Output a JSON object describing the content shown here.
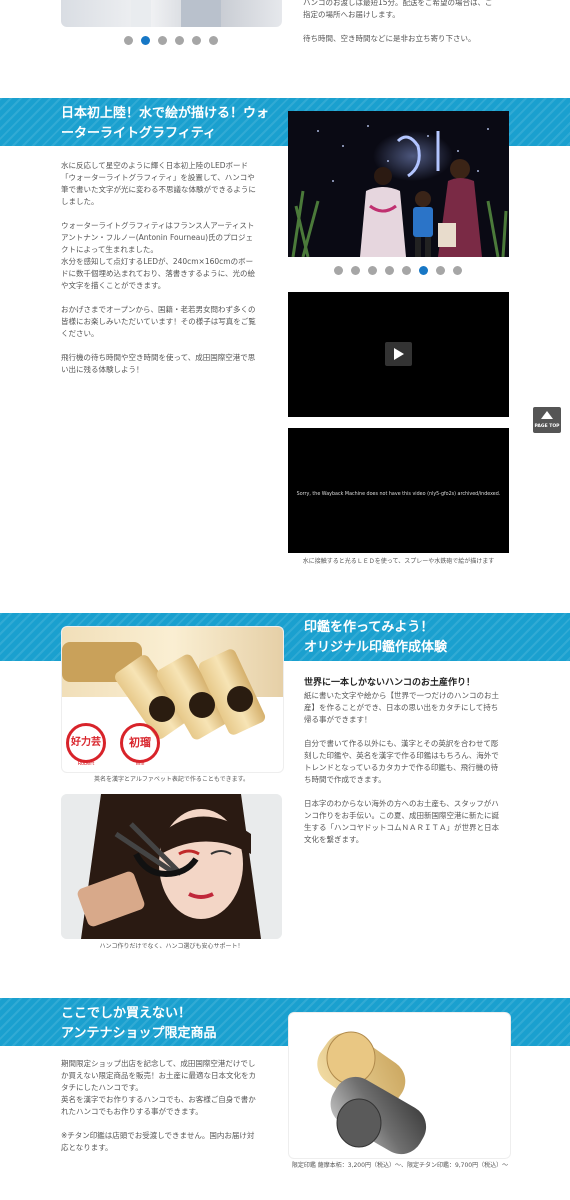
{
  "top": {
    "text_line1": "ハンコのお渡しは最短15分。配送をご希望の場合は、ご",
    "text_line2": "指定の場所へお届けします。",
    "text_line3": "待ち時間、空き時間などに是非お立ち寄り下さい。",
    "carousel_dots": 6,
    "carousel_active": 1
  },
  "section1": {
    "title": "日本初上陸！水で絵が描ける！ウォーターライトグラフィティ",
    "paragraphs": [
      "水に反応して星空のように輝く日本初上陸のLEDボード\n「ウォーターライトグラフィティ」を設置して、ハンコや\n筆で書いた文字が光に変わる不思議な体験ができるように\nしました。",
      "ウォーターライトグラフィティはフランス人アーティスト\nアントナン・フルノー(Antonin Fourneau)氏のプロジェ\nクトによって生まれました。\n水分を感知して点灯するLEDが、240cm×160cmのボー\nドに数千個埋め込まれており、落書きするように、光の絵\nや文字を描くことができます。",
      "おかげさまでオープンから、国籍・老若男女問わず多くの\n皆様にお楽しみいただいています！その様子は写真をご覧\nください。",
      "飛行機の待ち時間や空き時間を使って、成田国際空港で思\nい出に残る体験しよう！"
    ],
    "carousel_dots": 8,
    "carousel_active": 5,
    "video2_message": "Sorry, the Wayback Machine does not have this video (nly5-gfo2s) archived/indexed.",
    "video_caption": "水に接触すると光るＬＥＤを使って、スプレーや水鉄砲で絵が描けます"
  },
  "section2": {
    "title_line1": "印鑑を作ってみよう！",
    "title_line2": "オリジナル印鑑作成体験",
    "subheading": "世界に一本しかないハンコのお土産作り！",
    "paragraphs": [
      "紙に書いた文字や絵から【世界で一つだけのハンコのお土\n産】を作ることができ、日本の思い出をカタチにして持ち\n帰る事ができます！",
      "自分で書いて作る以外にも、漢字とその英訳を合わせて彫\n刻した印鑑や、英名を漢字で作る印鑑はもちろん、海外で\nトレンドとなっているカタカナで作る印鑑も、飛行機の待\nち時間で作成できます。",
      "日本字のわからない海外の方へのお土産も、スタッフがハ\nンコ作りをお手伝い。この夏、成田新国際空港に新たに誕\n生する「ハンコヤドットコムＮＡＲＩＴＡ」が世界と日本\n文化を繋ぎます。"
    ],
    "photo1_caption": "英名を漢字とアルファベット表記で作ることもできます。",
    "photo2_caption": "ハンコ作りだけでなく、ハンコ選びも安心サポート！",
    "stamp1_text": "好力芸",
    "stamp1_sub": "Robert",
    "stamp2_text": "初瑠",
    "stamp2_sub": "Will"
  },
  "section3": {
    "title_line1": "ここでしか買えない！",
    "title_line2": "アンテナショップ限定商品",
    "paragraphs": [
      "期間限定ショップ出店を記念して、成田国際空港だけでし\nか買えない限定商品を販売！お土産に最適な日本文化をカ\nタチにしたハンコです。\n英名を漢字でお作りするハンコでも、お客様ご自身で書か\nれたハンコでもお作りする事ができます。",
      "※チタン印鑑は店頭でお受渡しできません。国内お届け対\n応となります。"
    ],
    "photo_caption": "限定印鑑 薩摩本柘：3,200円（税込）〜、限定チタン印鑑：9,700円（税込）〜"
  },
  "page_top": {
    "label": "PAGE TOP",
    "icon": "arrow-up-icon"
  },
  "colors": {
    "banner": "#1aa0cf",
    "dot_active": "#1777c5",
    "dot": "#a6a6a6"
  }
}
